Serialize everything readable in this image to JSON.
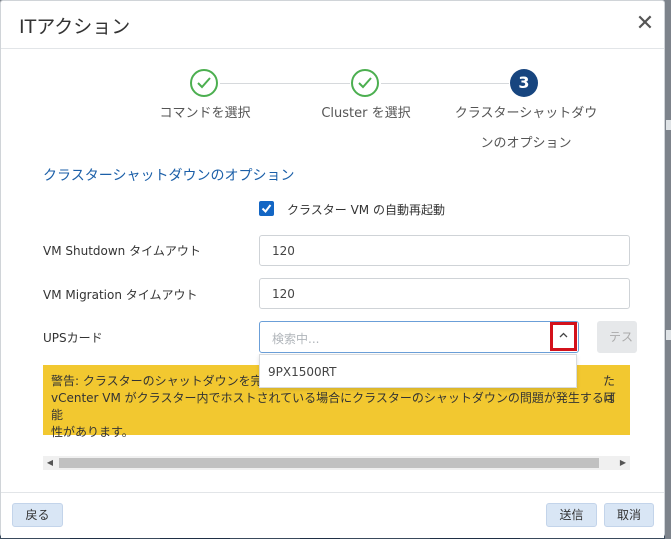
{
  "dialog": {
    "title": "ITアクション",
    "close_glyph": "✕"
  },
  "stepper": {
    "steps": [
      {
        "label": "コマンドを選択",
        "state": "done"
      },
      {
        "label": "Cluster を選択",
        "state": "done"
      },
      {
        "number": "3",
        "label_line1": "クラスターシャットダウ",
        "label_line2": "ンのオプション",
        "state": "active"
      }
    ],
    "colors": {
      "done": "#4caf50",
      "active": "#17457f"
    }
  },
  "form": {
    "section_title": "クラスターシャットダウンのオプション",
    "auto_restart": {
      "label": "クラスター VM の自動再起動",
      "checked": true
    },
    "vm_shutdown": {
      "label": "VM Shutdown タイムアウト",
      "value": "120"
    },
    "vm_migration": {
      "label": "VM Migration タイムアウト",
      "value": "120"
    },
    "ups_card": {
      "label": "UPSカード",
      "placeholder": "検索中...",
      "options": [
        "9PX1500RT"
      ],
      "chevron_icon": "chevron-up-icon"
    },
    "test_button_label": "テス"
  },
  "warning": {
    "line1_start": "警告: クラスターのシャットダウンを完",
    "line1_end": "たは",
    "line2": "vCenter VM がクラスター内でホストされている場合にクラスターのシャットダウンの問題が発生する可能",
    "line3": "性があります。",
    "color": "#f2c830"
  },
  "footer": {
    "back_label": "戻る",
    "send_label": "送信",
    "cancel_label": "取消"
  },
  "accent": {
    "highlight_border": "#d3111b",
    "link": "#1b5fa8"
  }
}
